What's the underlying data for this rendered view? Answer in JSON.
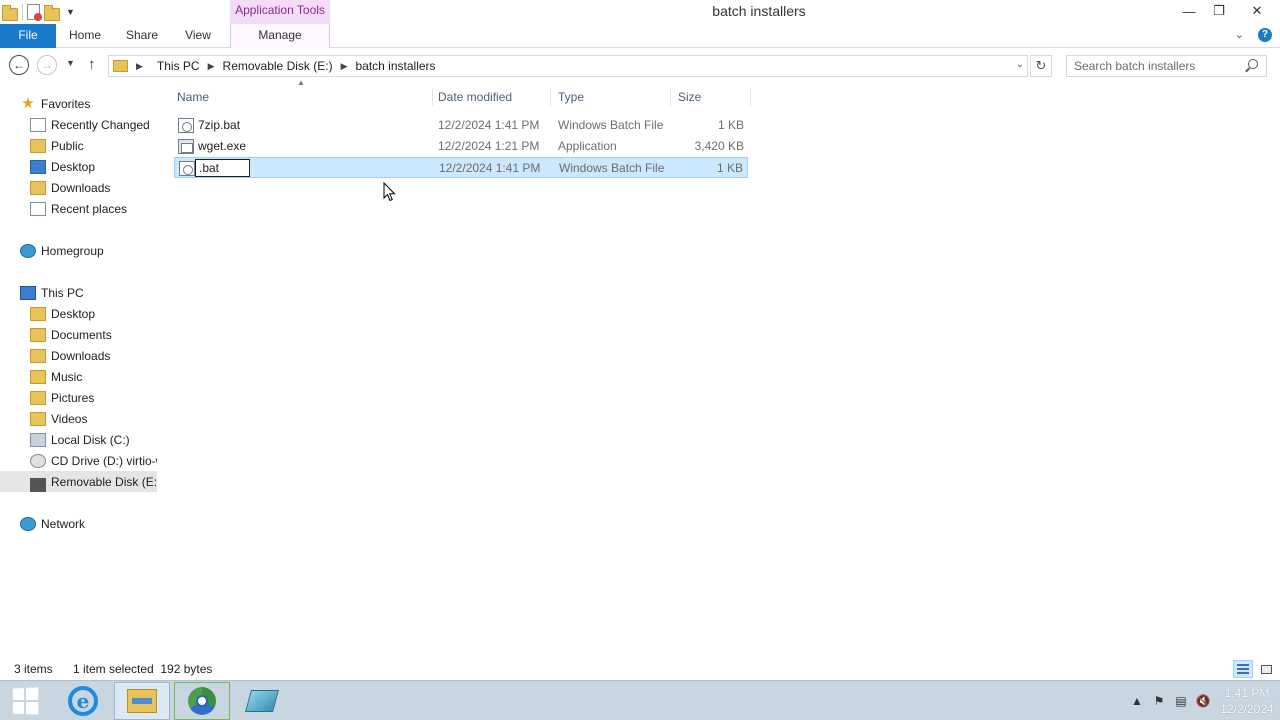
{
  "window": {
    "title": "batch installers",
    "context_tab_group": "Application Tools",
    "buttons": [
      "minimize",
      "restore",
      "close"
    ]
  },
  "ribbon": {
    "tabs": [
      {
        "label": "File",
        "active": true
      },
      {
        "label": "Home"
      },
      {
        "label": "Share"
      },
      {
        "label": "View"
      },
      {
        "label": "Manage",
        "contextual": true
      }
    ]
  },
  "address": {
    "crumbs": [
      "This PC",
      "Removable Disk (E:)",
      "batch installers"
    ],
    "search_placeholder": "Search batch installers"
  },
  "nav_pane": {
    "favorites_label": "Favorites",
    "favorites": [
      "Recently Changed",
      "Public",
      "Desktop",
      "Downloads",
      "Recent places"
    ],
    "homegroup_label": "Homegroup",
    "thispc_label": "This PC",
    "thispc_items": [
      "Desktop",
      "Documents",
      "Downloads",
      "Music",
      "Pictures",
      "Videos",
      "Local Disk (C:)",
      "CD Drive (D:) virtio-w",
      "Removable Disk (E:)"
    ],
    "network_label": "Network"
  },
  "columns": {
    "name": "Name",
    "date": "Date modified",
    "type": "Type",
    "size": "Size"
  },
  "files": [
    {
      "name": "7zip.bat",
      "date": "12/2/2024 1:41 PM",
      "type": "Windows Batch File",
      "size": "1 KB"
    },
    {
      "name": "wget.exe",
      "date": "12/2/2024 1:21 PM",
      "type": "Application",
      "size": "3,420 KB"
    },
    {
      "name": ".bat",
      "date": "12/2/2024 1:41 PM",
      "type": "Windows Batch File",
      "size": "1 KB",
      "selected": true,
      "renaming": true
    }
  ],
  "status": {
    "item_count": "3 items",
    "selection": "1 item selected  192 bytes"
  },
  "taskbar": {
    "clock_time": "1:41 PM",
    "clock_date": "12/2/2024"
  },
  "colors": {
    "file_tab": "#1979ca",
    "selection_bg": "#cce8ff",
    "selection_border": "#99d1ff",
    "context_tab": "#f3dcf7",
    "taskbar": "#c8d6e2"
  }
}
